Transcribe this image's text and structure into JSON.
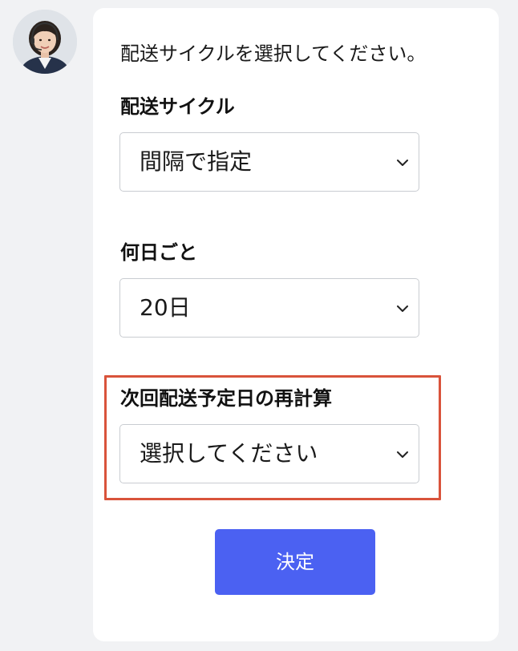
{
  "chat": {
    "intro_text": "配送サイクルを選択してください。"
  },
  "form": {
    "cycle": {
      "label": "配送サイクル",
      "selected": "間隔で指定"
    },
    "interval": {
      "label": "何日ごと",
      "selected": "20日"
    },
    "recalc": {
      "label": "次回配送予定日の再計算",
      "selected": "選択してください"
    },
    "submit_label": "決定"
  },
  "colors": {
    "accent": "#4b61f2",
    "highlight": "#d9533b",
    "background": "#f1f2f4",
    "card": "#ffffff"
  }
}
